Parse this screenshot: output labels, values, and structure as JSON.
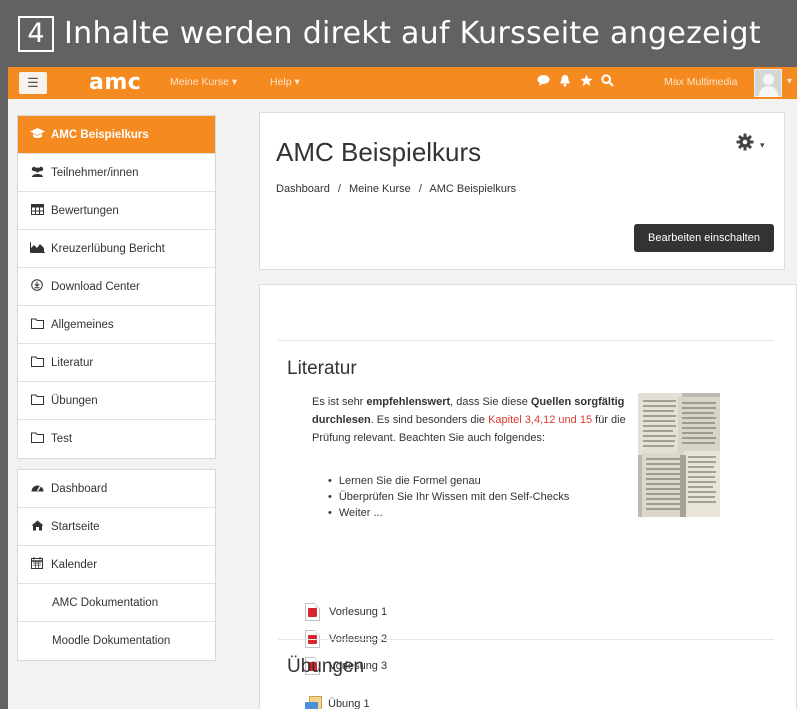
{
  "banner": {
    "step_number": "4",
    "title": "Inhalte werden direkt auf Kursseite angezeigt"
  },
  "navbar": {
    "menu_icon": "hamburger-icon",
    "logo": "amc",
    "meine_kurse": "Meine Kurse ▾",
    "help": "Help ▾",
    "icons": [
      "speech-bubble-icon",
      "bell-icon",
      "star-icon",
      "search-icon"
    ],
    "user_name": "Max Multimedia",
    "caret": "▾"
  },
  "sidebar": {
    "course_items": [
      {
        "icon": "graduation-cap-icon",
        "label": "AMC Beispielkurs",
        "active": true
      },
      {
        "icon": "users-icon",
        "label": "Teilnehmer/innen"
      },
      {
        "icon": "table-icon",
        "label": "Bewertungen"
      },
      {
        "icon": "area-chart-icon",
        "label": "Kreuzerlübung Bericht"
      },
      {
        "icon": "download-icon",
        "label": "Download Center"
      },
      {
        "icon": "folder-icon",
        "label": "Allgemeines"
      },
      {
        "icon": "folder-icon",
        "label": "Literatur"
      },
      {
        "icon": "folder-icon",
        "label": "Übungen"
      },
      {
        "icon": "folder-icon",
        "label": "Test"
      }
    ],
    "site_items": [
      {
        "icon": "dashboard-icon",
        "label": "Dashboard"
      },
      {
        "icon": "home-icon",
        "label": "Startseite"
      },
      {
        "icon": "calendar-icon",
        "label": "Kalender"
      },
      {
        "label": "AMC Dokumentation"
      },
      {
        "label": "Moodle Dokumentation"
      }
    ]
  },
  "header": {
    "course_title": "AMC Beispielkurs",
    "breadcrumb": [
      "Dashboard",
      "Meine Kurse",
      "AMC Beispielkurs"
    ],
    "breadcrumb_separator": "/",
    "edit_button": "Bearbeiten einschalten"
  },
  "content": {
    "literatur": {
      "title": "Literatur",
      "summary": {
        "p1": "Es ist sehr ",
        "b1": "empfehlenswert",
        "p2": ", dass Sie diese ",
        "b2": "Quellen sorgfältig durchlesen",
        "p3": ". Es sind besonders die ",
        "red": "Kapitel 3,4,12 und 15",
        "p4": " für die Prüfung relevant. Beachten Sie auch folgendes:"
      },
      "bullets": [
        "Lernen Sie die Formel genau",
        "Überprüfen Sie Ihr Wissen mit den Self-Checks",
        "Weiter ..."
      ],
      "resources": [
        "Vorlesung 1",
        "Vorlesung 2",
        "Vorlesung 3"
      ]
    },
    "uebungen": {
      "title": "Übungen",
      "resources": [
        "Übung 1"
      ]
    }
  },
  "colors": {
    "accent": "#f58a20",
    "highlight_text": "#e03a2f",
    "dark_button": "#333333"
  }
}
